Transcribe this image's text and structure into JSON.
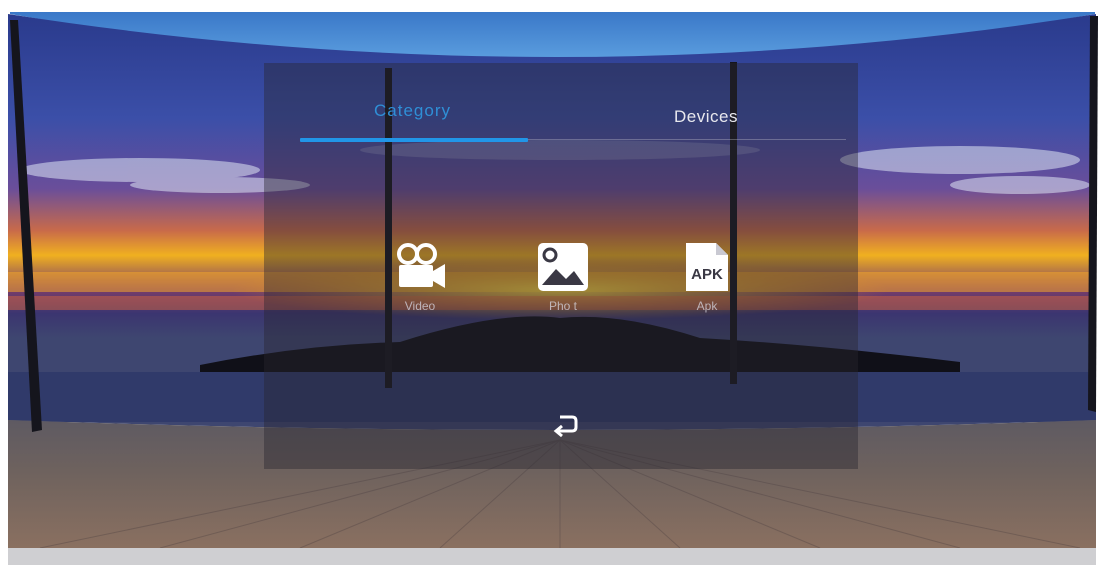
{
  "tabs": [
    {
      "label": "Category",
      "active": true
    },
    {
      "label": "Devices",
      "active": false
    }
  ],
  "categories": [
    {
      "label": "Video",
      "icon": "video-camera-icon"
    },
    {
      "label": "Pho t",
      "icon": "image-icon"
    },
    {
      "label": "Apk",
      "icon": "apk-file-icon",
      "icon_text": "APK"
    }
  ],
  "back": {
    "icon": "return-arrow-icon"
  },
  "colors": {
    "accent": "#2196e8",
    "active_tab_text": "#2f8fd6",
    "panel_overlay": "#28263a"
  }
}
